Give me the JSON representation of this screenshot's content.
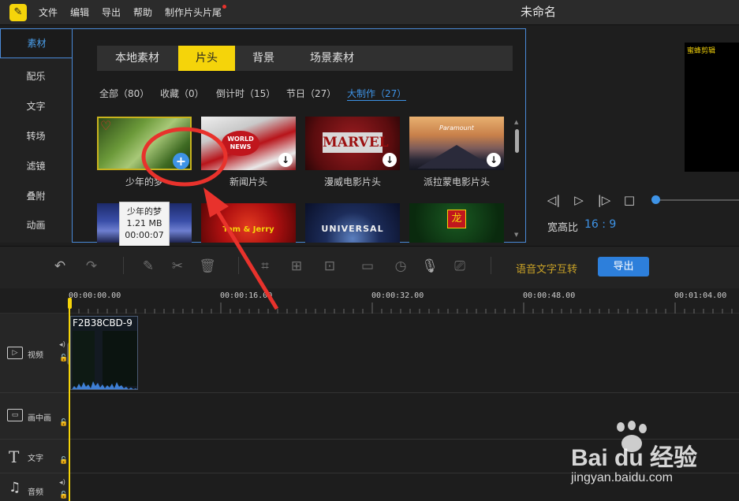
{
  "topbar": {
    "logo_glyph": "✎",
    "menus": [
      "文件",
      "编辑",
      "导出",
      "帮助",
      "制作片头片尾"
    ],
    "title": "未命名"
  },
  "leftnav": {
    "active": "素材",
    "items": [
      "配乐",
      "文字",
      "转场",
      "滤镜",
      "叠附",
      "动画"
    ]
  },
  "media": {
    "tabs": [
      "本地素材",
      "片头",
      "背景",
      "场景素材"
    ],
    "categories": [
      "全部（80）",
      "收藏（0）",
      "倒计时（15）",
      "节日（27）",
      "大制作（27）"
    ],
    "items": [
      {
        "label": "少年的梦"
      },
      {
        "label": "新闻片头",
        "thumb_text": "WORLD NEWS"
      },
      {
        "label": "漫威电影片头",
        "thumb_text": "MARVEL"
      },
      {
        "label": "派拉蒙电影片头",
        "thumb_text": "Paramount"
      }
    ],
    "row2_texts": [
      "",
      "Tom & Jerry",
      "UNIVERSAL",
      ""
    ],
    "tooltip": {
      "name": "少年的梦",
      "size": "1.21 MB",
      "duration": "00:00:07"
    }
  },
  "preview": {
    "watermark": "蜜蜂剪辑",
    "aspect_label": "宽高比",
    "aspect_value": "16 : 9"
  },
  "toolbar": {
    "voice_label": "语音文字互转",
    "export_label": "导出"
  },
  "ruler": {
    "timecodes": [
      "00:00:00.00",
      "00:00:16.00",
      "00:00:32.00",
      "00:00:48.00",
      "00:01:04.00"
    ]
  },
  "tracks": {
    "video": "视频",
    "pip": "画中画",
    "text": "文字",
    "audio": "音频",
    "clip_name": "F2B38CBD-9"
  },
  "watermark": {
    "brand": "Bai du 经验",
    "url": "jingyan.baidu.com"
  },
  "colors": {
    "accent": "#f5d40a",
    "blue": "#3e93e6",
    "annotation": "#e8322c"
  }
}
